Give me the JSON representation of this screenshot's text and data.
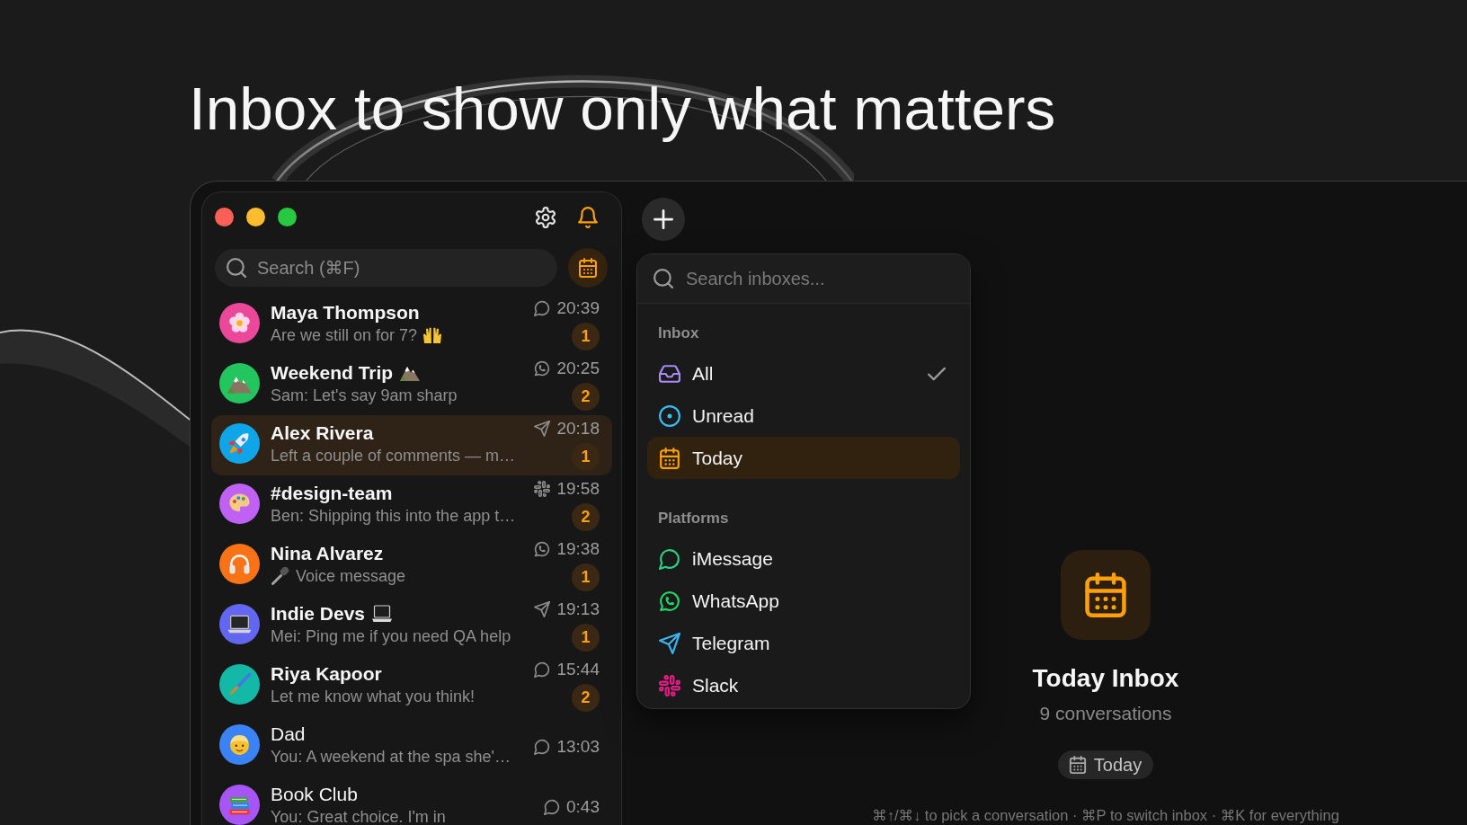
{
  "headline": "Inbox to show only what matters",
  "sidebar": {
    "search": {
      "placeholder": "Search (⌘F)"
    },
    "conversations": [
      {
        "name": "Maya Thompson",
        "preview": "Are we still on for 7?",
        "time": "20:39",
        "kind": "imessage",
        "color": "#ec4899",
        "unread": true,
        "badge": "1",
        "selected": false
      },
      {
        "name": "Weekend Trip",
        "preview": "Sam: Let's say 9am sharp",
        "time": "20:25",
        "kind": "whatsapp",
        "color": "#22c55e",
        "unread": true,
        "badge": "2",
        "selected": false
      },
      {
        "name": "Alex Rivera",
        "preview": "Left a couple of comments — m…",
        "time": "20:18",
        "kind": "telegram",
        "color": "#0ea5e9",
        "unread": true,
        "badge": "1",
        "selected": true
      },
      {
        "name": "#design-team",
        "preview": "Ben: Shipping this into the app t…",
        "time": "19:58",
        "kind": "slack",
        "color": "#c061f5",
        "unread": true,
        "badge": "2",
        "selected": false
      },
      {
        "name": "Nina Alvarez",
        "preview": "Voice message",
        "time": "19:38",
        "kind": "whatsapp",
        "color": "#f97316",
        "unread": true,
        "badge": "1",
        "selected": false
      },
      {
        "name": "Indie Devs",
        "preview": "Mei: Ping me if you need QA help",
        "time": "19:13",
        "kind": "telegram",
        "color": "#6366f1",
        "unread": true,
        "badge": "1",
        "selected": false
      },
      {
        "name": "Riya Kapoor",
        "preview": "Let me know what you think!",
        "time": "15:44",
        "kind": "imessage",
        "color": "#14b8a6",
        "unread": true,
        "badge": "2",
        "selected": false
      },
      {
        "name": "Dad",
        "preview": "You: A weekend at the spa she'…",
        "time": "13:03",
        "kind": "imessage",
        "color": "#3b82f6",
        "unread": false,
        "selected": false
      },
      {
        "name": "Book Club",
        "preview": "You: Great choice. I'm in",
        "time": "0:43",
        "kind": "imessage",
        "color": "#a855f7",
        "unread": false,
        "selected": false
      }
    ]
  },
  "inbox_menu": {
    "search": {
      "placeholder": "Search inboxes..."
    },
    "sections": [
      {
        "heading": "Inbox",
        "items": [
          {
            "label": "All",
            "kind": "all",
            "checked": true,
            "selected": false
          },
          {
            "label": "Unread",
            "kind": "unread",
            "checked": false,
            "selected": false
          },
          {
            "label": "Today",
            "kind": "today",
            "checked": false,
            "selected": true
          }
        ]
      },
      {
        "heading": "Platforms",
        "items": [
          {
            "label": "iMessage",
            "kind": "imessage",
            "checked": false,
            "selected": false
          },
          {
            "label": "WhatsApp",
            "kind": "whatsapp",
            "checked": false,
            "selected": false
          },
          {
            "label": "Telegram",
            "kind": "telegram",
            "checked": false,
            "selected": false
          },
          {
            "label": "Slack",
            "kind": "slack",
            "checked": false,
            "selected": false
          }
        ]
      }
    ]
  },
  "empty_state": {
    "title": "Today Inbox",
    "count": "9 conversations",
    "chip": "Today"
  },
  "shortcut_hint": "⌘↑/⌘↓ to pick a conversation · ⌘P to switch inbox · ⌘K for everything"
}
